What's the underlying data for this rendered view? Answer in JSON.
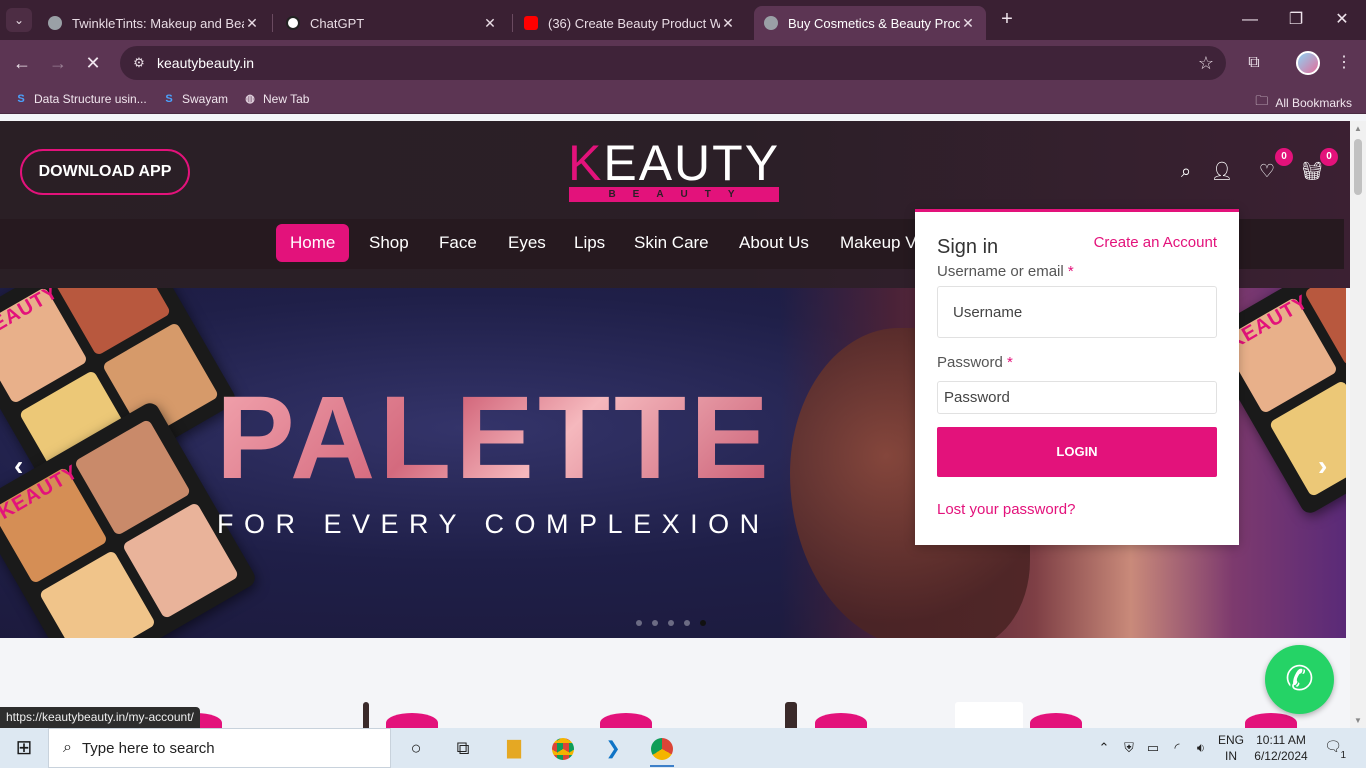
{
  "browser": {
    "tabs": [
      {
        "title": "TwinkleTints: Makeup and Beauty",
        "favicon_color": "#9aa0a6"
      },
      {
        "title": "ChatGPT",
        "favicon_color": "#ffffff"
      },
      {
        "title": "(36) Create Beauty Product Web",
        "favicon_color": "#ff0000"
      },
      {
        "title": "Buy Cosmetics & Beauty Products",
        "favicon_color": "#9aa0a6"
      }
    ],
    "url": "keautybeauty.in",
    "bookmarks": [
      {
        "label": "Data Structure usin...",
        "icon": "S"
      },
      {
        "label": "Swayam",
        "icon": "S"
      },
      {
        "label": "New Tab",
        "icon": "globe-icon"
      }
    ],
    "all_bookmarks": "All Bookmarks"
  },
  "site": {
    "download_app": "DOWNLOAD APP",
    "logo": {
      "k": "K",
      "rest": "EAUTY",
      "sub": "BEAUTY"
    },
    "wishlist_count": "0",
    "cart_count": "0",
    "nav": [
      "Home",
      "Shop",
      "Face",
      "Eyes",
      "Lips",
      "Skin Care",
      "About Us",
      "Makeup V"
    ],
    "hero": {
      "title": "PALETTE",
      "subtitle": "FOR EVERY COMPLEXION",
      "palette_brand": "KEAUTY",
      "slides": 5,
      "active_slide": 5
    }
  },
  "signin": {
    "title": "Sign in",
    "create_account": "Create an Account",
    "username_label": "Username or email",
    "username_placeholder": "Username",
    "password_label": "Password",
    "password_placeholder": "Password",
    "required_mark": "*",
    "login": "LOGIN",
    "lost_password": "Lost your password?"
  },
  "status_url": "https://keautybeauty.in/my-account/",
  "taskbar": {
    "search_placeholder": "Type here to search",
    "lang_top": "ENG",
    "lang_bottom": "IN",
    "time": "10:11 AM",
    "date": "6/12/2024",
    "notification_count": "1"
  },
  "colors": {
    "brand": "#e3127b",
    "whatsapp": "#25d366"
  }
}
